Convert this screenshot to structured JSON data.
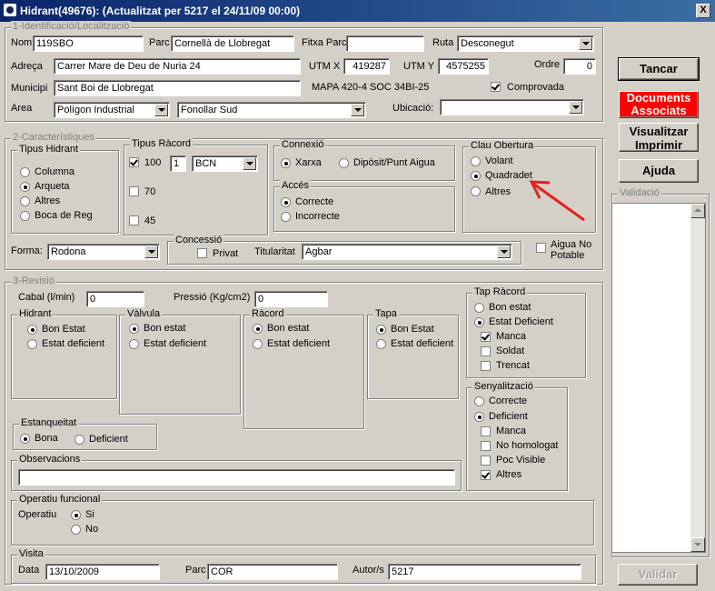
{
  "window": {
    "title": "Hidrant(49676): (Actualitzat per 5217 el 24/11/09 00:00)",
    "close": "X"
  },
  "sec1": {
    "title": "1-Identificació/Localització",
    "nom_label": "Nom",
    "nom": "119SBO",
    "parc_label": "Parc",
    "parc": "Cornellà de Llobregat",
    "fitxa_label": "Fitxa Parc",
    "fitxa": "",
    "ruta_label": "Ruta",
    "ruta": "Desconegut",
    "adreca_label": "Adreça",
    "adreca": "Carrer Mare de Deu de Nuria 24",
    "utmx_label": "UTM X",
    "utmx": "419287",
    "utmy_label": "UTM Y",
    "utmy": "4575255",
    "ordre_label": "Ordre",
    "ordre": "0",
    "municipi_label": "Municipi",
    "municipi": "Sant Boi de Llobregat",
    "mapa": "MAPA 420-4 SOC 34BI-25",
    "comprovada_label": "Comprovada",
    "area_label": "Area",
    "area1": "Polígon Industrial",
    "area2": "Fonollar Sud",
    "ubicacio_label": "Ubicació:",
    "ubicacio": ""
  },
  "sec2": {
    "title": "2-Característiques",
    "tipus_hidrant": {
      "title": "Tipus Hidrant",
      "options": [
        "Columna",
        "Arqueta",
        "Altres",
        "Boca de Reg"
      ]
    },
    "tipus_racord": {
      "title": "Tipus Ràcord",
      "opt100": "100",
      "qty": "1",
      "type": "BCN",
      "opt70": "70",
      "opt45": "45"
    },
    "connexio": {
      "title": "Connexió",
      "xarxa": "Xarxa",
      "diposit": "Dipòsit/Punt Aigua"
    },
    "acces": {
      "title": "Accés",
      "correcte": "Correcte",
      "incorrecte": "Incorrecte"
    },
    "clau": {
      "title": "Clau Obertura",
      "options": [
        "Volant",
        "Quadradet",
        "Altres"
      ]
    },
    "forma_label": "Forma:",
    "forma": "Rodona",
    "concessio": {
      "title": "Concessió",
      "privat": "Privat",
      "titularitat_label": "Titularitat",
      "titularitat": "Agbar"
    },
    "aigua_no_potable": "Aigua No Potable"
  },
  "sec3": {
    "title": "3-Revisió",
    "cabal_label": "Cabal (l/min)",
    "cabal": "0",
    "pressio_label": "Pressió (Kg/cm2)",
    "pressio": "0",
    "hidrant": {
      "title": "Hidrant",
      "bon": "Bon Estat",
      "def": "Estat deficient"
    },
    "valvula": {
      "title": "Vàlvula",
      "bon": "Bon estat",
      "def": "Estat deficient"
    },
    "racord": {
      "title": "Ràcord",
      "bon": "Bon estat",
      "def": "Estat deficient"
    },
    "tapa": {
      "title": "Tapa",
      "bon": "Bon Estat",
      "def": "Estat deficient"
    },
    "tap_racord": {
      "title": "Tap Ràcord",
      "bon": "Bon estat",
      "def": "Estat Deficient",
      "manca": "Manca",
      "soldat": "Soldat",
      "trencat": "Trencat"
    },
    "senyalitzacio": {
      "title": "Senyalització",
      "correcte": "Correcte",
      "deficient": "Deficient",
      "manca": "Manca",
      "no_homologat": "No homologat",
      "poc_visible": "Poc Visible",
      "altres": "Altres"
    },
    "estanqueitat": {
      "title": "Estanqueitat",
      "bona": "Bona",
      "deficient": "Deficient"
    },
    "observacions": {
      "title": "Observacions",
      "value": ""
    },
    "operatiu": {
      "title": "Operatiu funcional",
      "label": "Operatiu",
      "si": "Si",
      "no": "No"
    },
    "visita": {
      "title": "Visita",
      "data_label": "Data",
      "data": "13/10/2009",
      "parc_label": "Parc",
      "parc": "COR",
      "autor_label": "Autor/s",
      "autor": "5217"
    }
  },
  "side": {
    "tancar": "Tancar",
    "docs1": "Documents",
    "docs2": "Associats",
    "vis1": "Visualitzar",
    "vis2": "Imprimir",
    "ajuda": "Ajuda",
    "validacio": "Validació",
    "validar": "Validar"
  },
  "annotation_color": "#e8201c"
}
